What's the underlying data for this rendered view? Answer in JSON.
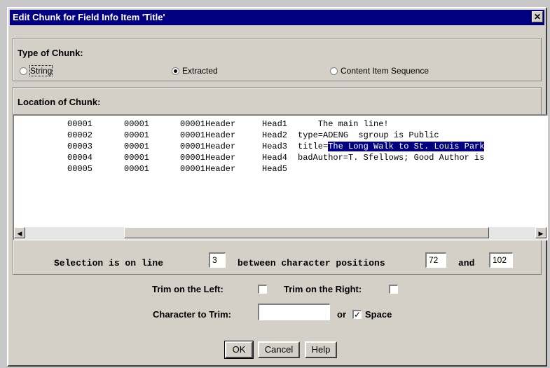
{
  "dialog": {
    "title": "Edit Chunk for Field Info Item 'Title'",
    "close_glyph": "✕"
  },
  "type_of_chunk": {
    "header": "Type of Chunk:",
    "options": [
      {
        "label": "String",
        "selected": false
      },
      {
        "label": "Extracted",
        "selected": true
      },
      {
        "label": "Content Item Sequence",
        "selected": false
      }
    ]
  },
  "location": {
    "header": "Location of Chunk:",
    "rows": [
      {
        "a": "00001",
        "b": "00001",
        "c": "00001Header",
        "d": "Head1",
        "text": "    The main line!",
        "sel_pre": "",
        "sel": ""
      },
      {
        "a": "00002",
        "b": "00001",
        "c": "00001Header",
        "d": "Head2",
        "text": "type=ADENG  sgroup is Public",
        "sel_pre": "",
        "sel": ""
      },
      {
        "a": "00003",
        "b": "00001",
        "c": "00001Header",
        "d": "Head3",
        "text": "",
        "sel_pre": "title=",
        "sel": "The Long Walk to St. Louis Park"
      },
      {
        "a": "00004",
        "b": "00001",
        "c": "00001Header",
        "d": "Head4",
        "text": "badAuthor=T. Sfellows; Good Author is",
        "sel_pre": "",
        "sel": ""
      },
      {
        "a": "00005",
        "b": "00001",
        "c": "00001Header",
        "d": "Head5",
        "text": "",
        "sel_pre": "",
        "sel": ""
      }
    ]
  },
  "selection": {
    "prefix": "Selection is on line",
    "line": "3",
    "middle": "between character positions",
    "start": "72",
    "and_label": "and",
    "end": "102"
  },
  "trim": {
    "left_label": "Trim on the Left:",
    "right_label": "Trim on the Right:",
    "char_label": "Character to Trim:",
    "char_value": "",
    "or_label": "or",
    "space_label": "Space",
    "space_checked_glyph": "✓"
  },
  "buttons": {
    "ok": "OK",
    "cancel": "Cancel",
    "help": "Help"
  }
}
